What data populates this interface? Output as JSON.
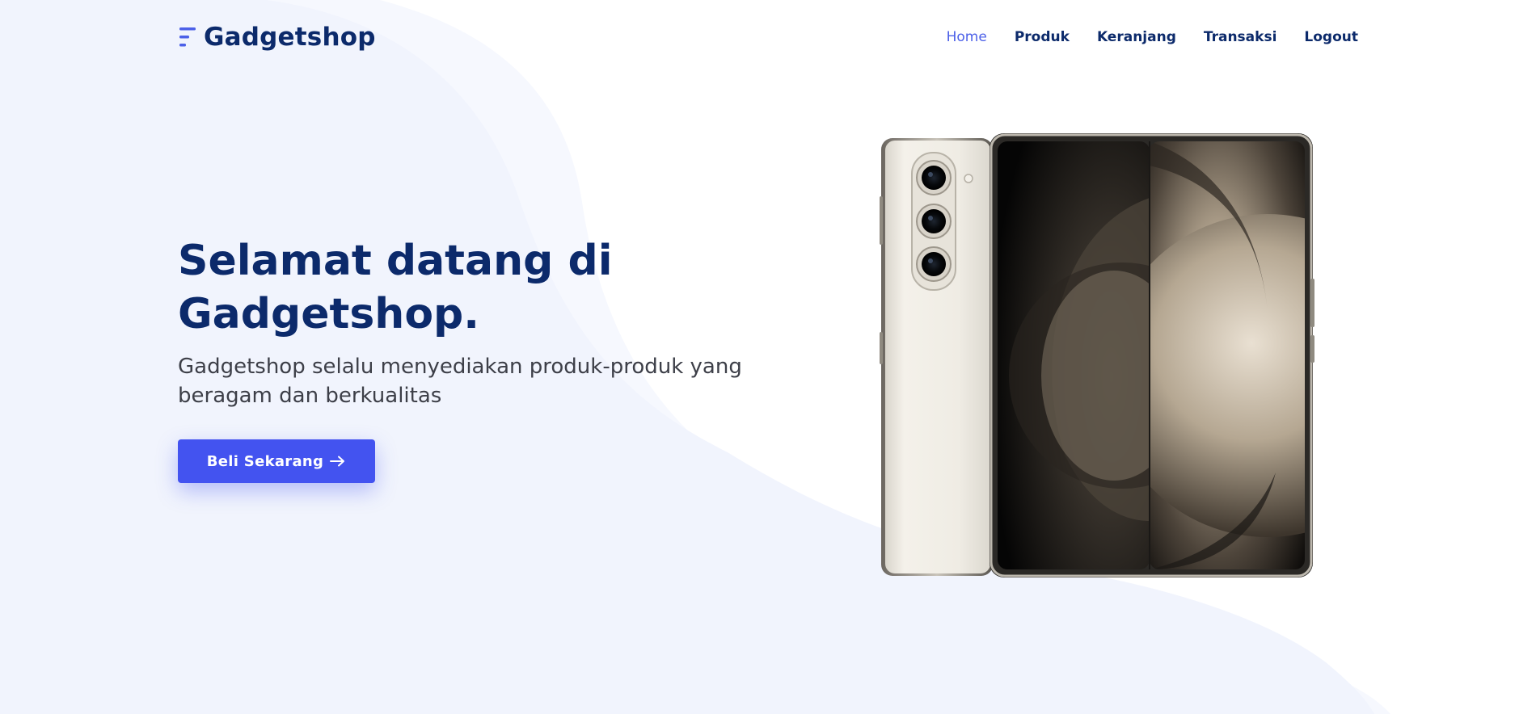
{
  "header": {
    "brand": "Gadgetshop",
    "nav": [
      {
        "label": "Home",
        "active": true
      },
      {
        "label": "Produk",
        "active": false
      },
      {
        "label": "Keranjang",
        "active": false
      },
      {
        "label": "Transaksi",
        "active": false
      },
      {
        "label": "Logout",
        "active": false
      }
    ]
  },
  "hero": {
    "title": "Selamat datang di Gadgetshop.",
    "subtitle": "Gadgetshop selalu menyediakan produk-produk yang beragam dan berkualitas",
    "cta_label": "Beli Sekarang",
    "cta_icon": "arrow-right-icon",
    "image_icon": "foldable-phone-image"
  },
  "colors": {
    "primary": "#4353f0",
    "navy": "#0c2a6b",
    "active_link": "#4c60e8",
    "bg_wave": "#f1f4fd"
  }
}
